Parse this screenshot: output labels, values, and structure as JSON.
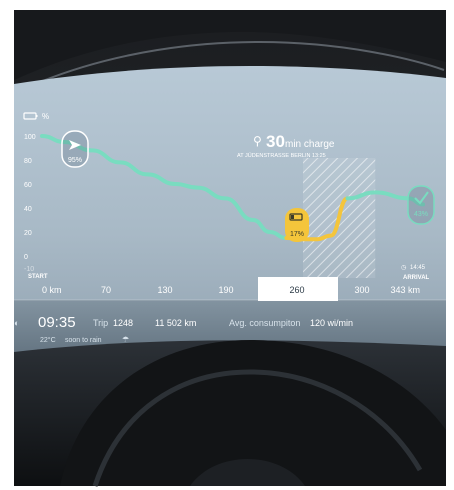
{
  "battery": {
    "unit_label": "%",
    "icon": "battery-icon"
  },
  "charge": {
    "icon": "plug-icon",
    "duration": "30",
    "unit_text": "min charge",
    "location": "AT JÜDENSTRASSE BERLIN 13:25",
    "level_label": "17%"
  },
  "route": {
    "start_label": "START",
    "start_level": "95%",
    "arrival_label": "ARRIVAL",
    "arrival_time": "14:45",
    "arrival_level": "43%",
    "selected_tick": "260"
  },
  "chart_data": {
    "type": "line",
    "xlabel": "",
    "ylabel": "%",
    "y_ticks": [
      "100",
      "80",
      "60",
      "40",
      "20",
      "0",
      "-10"
    ],
    "x_ticks": [
      "0 km",
      "70",
      "130",
      "190",
      "260",
      "300",
      "343 km"
    ],
    "series": [
      {
        "values_km": [
          0,
          20,
          45,
          70,
          95,
          120,
          140,
          165,
          190,
          205,
          220,
          235,
          248,
          260,
          275,
          300,
          330,
          343
        ],
        "values_pct": [
          100,
          95,
          88,
          78,
          68,
          60,
          57,
          48,
          30,
          20,
          15,
          14,
          14,
          17,
          48,
          53,
          48,
          43
        ]
      }
    ],
    "ylim": [
      -10,
      100
    ],
    "xlim": [
      0,
      343
    ],
    "charge_window_km": [
      235,
      300
    ]
  },
  "status": {
    "time": "09:35",
    "trip_label": "Trip",
    "trip_value": "1248",
    "odometer": "11 502 km",
    "consumption_label": "Avg. consumpiton",
    "consumption_value": "120 wi/min",
    "weather_temp": "22°C",
    "weather_text": "soon to rain"
  },
  "colors": {
    "screen_bg": "#a7b8c6",
    "line_green": "#79dcc0",
    "line_yellow": "#f4c53b",
    "badge_yellow": "#f4c53b",
    "frame_dark": "#171a1d"
  }
}
